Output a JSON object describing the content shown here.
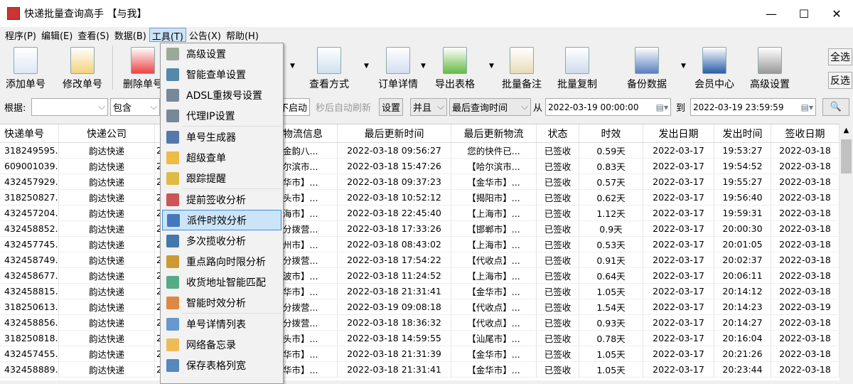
{
  "window": {
    "title": "快递批量查询高手 【与我】",
    "minimize": "—",
    "maximize": "☐",
    "close": "✕"
  },
  "menubar": [
    "程序(P)",
    "编辑(E)",
    "查看(S)",
    "数据(B)",
    "工具(T)",
    "公告(X)",
    "帮助(H)"
  ],
  "toolbar": {
    "items": [
      "添加单号",
      "修改单号",
      "删除单号",
      "查看方式",
      "订单详情",
      "导出表格",
      "批量备注",
      "批量复制",
      "备份数据",
      "会员中心",
      "高级设置"
    ],
    "select_all": "全选",
    "invert": "反选"
  },
  "filter": {
    "basis_label": "根据:",
    "basis_value": "",
    "match": "包含",
    "start_btn": "不启动",
    "auto_refresh": "秒后自动刷新",
    "settings_btn": "设置",
    "logic": "并且",
    "time_field": "最后查询时间",
    "from_label": "从",
    "from": "2022-03-19 00:00:00",
    "to_label": "到",
    "to": "2022-03-19 23:59:59"
  },
  "table": {
    "headers": [
      "快递单号",
      "快递公司",
      "",
      "物流信息",
      "最后更新时间",
      "最后更新物流",
      "状态",
      "时效",
      "发出日期",
      "发出时间",
      "签收日期"
    ],
    "rows": [
      [
        "318249595...",
        "韵达快递",
        "2",
        "金韵八...",
        "2022-03-18 09:56:27",
        "您的快件已...",
        "已签收",
        "0.59天",
        "2022-03-17",
        "19:53:27",
        "2022-03-18"
      ],
      [
        "609001039...",
        "韵达快递",
        "2",
        "尔滨市...",
        "2022-03-18 15:47:26",
        "【哈尔滨市...",
        "已签收",
        "0.83天",
        "2022-03-17",
        "19:54:52",
        "2022-03-18"
      ],
      [
        "432457929...",
        "韵达快递",
        "2",
        "华市】...",
        "2022-03-18 09:37:23",
        "【金华市】...",
        "已签收",
        "0.57天",
        "2022-03-17",
        "19:55:27",
        "2022-03-18"
      ],
      [
        "318250827...",
        "韵达快递",
        "2",
        "头市】...",
        "2022-03-18 10:52:12",
        "【揭阳市】...",
        "已签收",
        "0.62天",
        "2022-03-17",
        "19:56:40",
        "2022-03-18"
      ],
      [
        "432457204...",
        "韵达快递",
        "2",
        "海市】...",
        "2022-03-18 22:45:40",
        "【上海市】...",
        "已签收",
        "1.12天",
        "2022-03-17",
        "19:59:31",
        "2022-03-18"
      ],
      [
        "432458852...",
        "韵达快递",
        "2",
        "分拨营...",
        "2022-03-18 17:33:26",
        "【邯郸市】...",
        "已签收",
        "0.9天",
        "2022-03-17",
        "20:00:30",
        "2022-03-18"
      ],
      [
        "432457745...",
        "韵达快递",
        "2",
        "州市】...",
        "2022-03-18 08:43:02",
        "【上海市】...",
        "已签收",
        "0.53天",
        "2022-03-17",
        "20:01:05",
        "2022-03-18"
      ],
      [
        "432458749...",
        "韵达快递",
        "2",
        "分拨营...",
        "2022-03-18 17:54:22",
        "【代收点】...",
        "已签收",
        "0.91天",
        "2022-03-17",
        "20:02:37",
        "2022-03-18"
      ],
      [
        "432458677...",
        "韵达快递",
        "2",
        "波市】...",
        "2022-03-18 11:24:52",
        "【上海市】...",
        "已签收",
        "0.64天",
        "2022-03-17",
        "20:06:11",
        "2022-03-18"
      ],
      [
        "432458815...",
        "韵达快递",
        "2",
        "华市】...",
        "2022-03-18 21:31:41",
        "【金华市】...",
        "已签收",
        "1.05天",
        "2022-03-17",
        "20:14:12",
        "2022-03-18"
      ],
      [
        "318250613...",
        "韵达快递",
        "2",
        "分拨营...",
        "2022-03-19 09:08:18",
        "【代收点】...",
        "已签收",
        "1.54天",
        "2022-03-17",
        "20:14:23",
        "2022-03-19"
      ],
      [
        "432458856...",
        "韵达快递",
        "2",
        "分拨营...",
        "2022-03-18 18:36:32",
        "【代收点】...",
        "已签收",
        "0.93天",
        "2022-03-17",
        "20:14:27",
        "2022-03-18"
      ],
      [
        "318250818...",
        "韵达快递",
        "2",
        "头市】...",
        "2022-03-18 14:59:55",
        "【汕尾市】...",
        "已签收",
        "0.78天",
        "2022-03-17",
        "20:16:04",
        "2022-03-18"
      ],
      [
        "432457455...",
        "韵达快递",
        "2",
        "华市】...",
        "2022-03-18 21:31:39",
        "【金华市】...",
        "已签收",
        "1.05天",
        "2022-03-17",
        "20:21:26",
        "2022-03-18"
      ],
      [
        "432458889...",
        "韵达快递",
        "2",
        "华市】...",
        "2022-03-18 21:31:41",
        "【金华市】...",
        "已签收",
        "1.05天",
        "2022-03-17",
        "20:23:44",
        "2022-03-18"
      ]
    ]
  },
  "tools_menu": {
    "items": [
      "高级设置",
      "智能查单设置",
      "ADSL重拨号设置",
      "代理IP设置",
      "单号生成器",
      "超级查单",
      "跟踪提醒",
      "提前签收分析",
      "派件时效分析",
      "多次揽收分析",
      "重点路向时限分析",
      "收货地址智能匹配",
      "智能时效分析",
      "单号详情列表",
      "网络备忘录",
      "保存表格列宽"
    ],
    "highlighted": "派件时效分析"
  },
  "colors": {
    "accent": "#3c8de0",
    "highlight": "#cce4f7"
  }
}
